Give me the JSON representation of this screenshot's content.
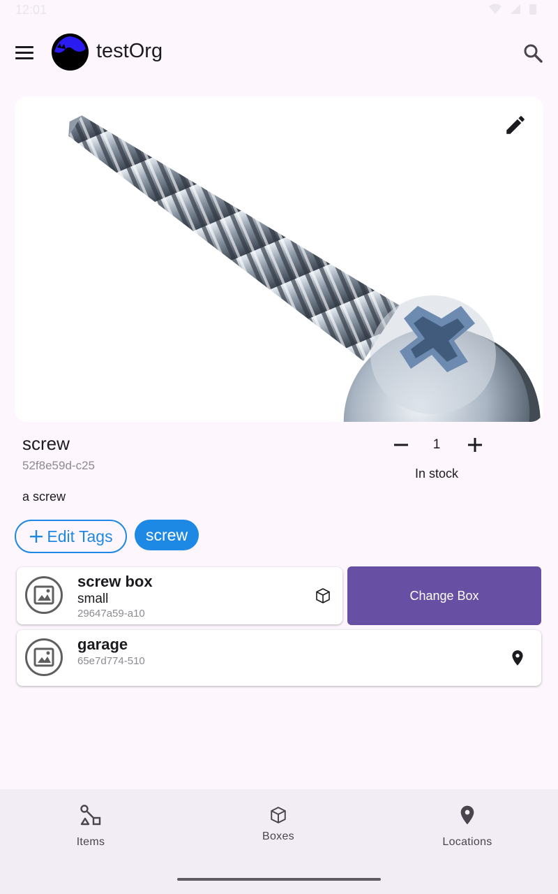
{
  "status_bar": {
    "time": "12:01"
  },
  "app_bar": {
    "org_name": "testOrg",
    "menu_icon": "menu-icon",
    "search_icon": "search-icon"
  },
  "item": {
    "name": "screw",
    "id": "52f8e59d-c25",
    "description": "a screw",
    "quantity": "1",
    "stock_status": "In stock"
  },
  "tags": {
    "edit_label": "Edit Tags",
    "items": [
      "screw"
    ]
  },
  "box": {
    "name": "screw box",
    "size": "small",
    "id": "29647a59-a10",
    "change_label": "Change Box"
  },
  "location": {
    "name": "garage",
    "id": "65e7d774-510"
  },
  "bottom_nav": {
    "items": [
      {
        "label": "Items",
        "icon": "items-icon"
      },
      {
        "label": "Boxes",
        "icon": "box-icon"
      },
      {
        "label": "Locations",
        "icon": "location-pin-icon"
      }
    ]
  },
  "colors": {
    "accent_blue": "#1e88e5",
    "primary_purple": "#6750a4",
    "background": "#fdf7fd"
  }
}
